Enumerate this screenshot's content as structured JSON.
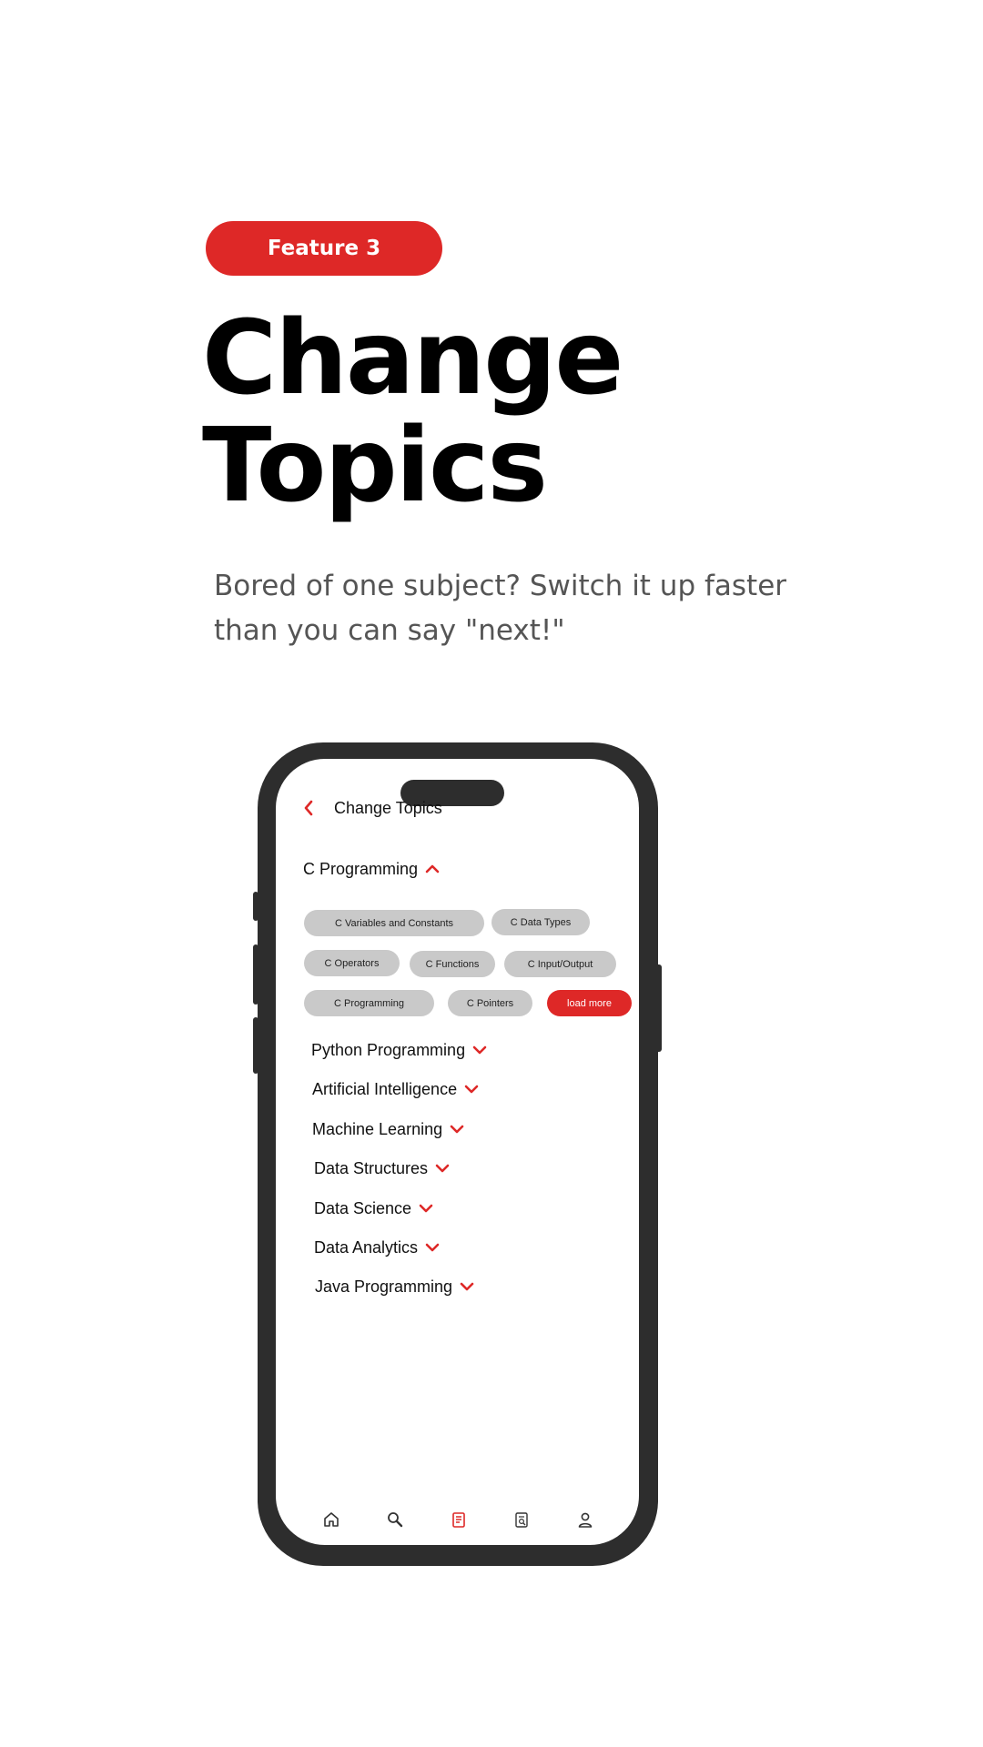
{
  "badge": {
    "label": "Feature 3"
  },
  "headline": {
    "line1": "Change",
    "line2": "Topics"
  },
  "subtitle": "Bored of one subject? Switch it up faster than you can say \"next!\"",
  "accent_color": "#de2827",
  "phone": {
    "header": {
      "back_icon": "chevron-left-icon",
      "title": "Change Topics"
    },
    "expanded_topic": {
      "label": "C Programming",
      "icon": "chevron-up-icon"
    },
    "subtopics": [
      "C Variables and Constants",
      "C Data Types",
      "C Operators",
      "C Functions",
      "C Input/Output",
      "C Programming",
      "C Pointers"
    ],
    "load_more_label": "load more",
    "topics": [
      "Python Programming",
      "Artificial Intelligence",
      "Machine Learning",
      "Data Structures",
      "Data Science",
      "Data Analytics",
      "Java Programming"
    ],
    "bottom_nav": [
      {
        "icon": "home-icon",
        "active": false
      },
      {
        "icon": "search-icon",
        "active": false
      },
      {
        "icon": "notes-icon",
        "active": true
      },
      {
        "icon": "document-search-icon",
        "active": false
      },
      {
        "icon": "profile-icon",
        "active": false
      }
    ]
  }
}
